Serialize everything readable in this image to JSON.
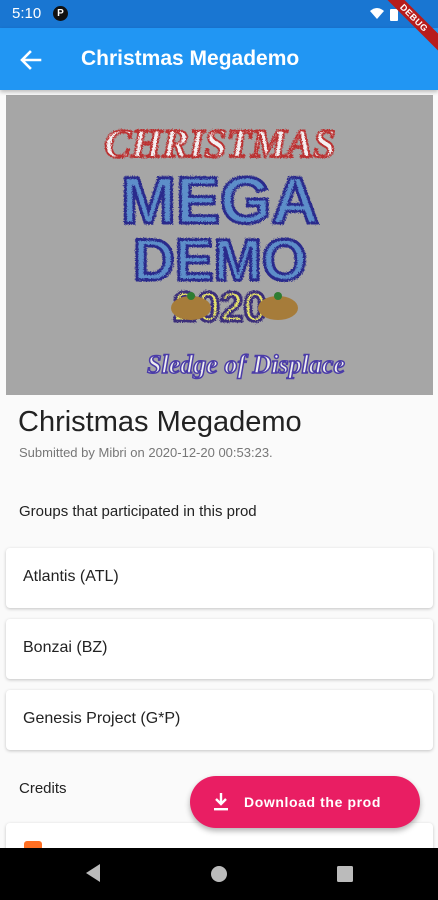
{
  "status_bar": {
    "time": "5:10",
    "notification_icon": "P"
  },
  "debug_banner": "DEBUG",
  "app_bar": {
    "title": "Christmas Megademo",
    "back_icon": "arrow-left"
  },
  "cover": {
    "background": "#a6a6a6",
    "logo_lines": [
      "CHRISTMAS",
      "MEGA",
      "DEMO",
      "2020"
    ],
    "signature": "Sledge of Displace"
  },
  "prod": {
    "title": "Christmas Megademo",
    "submitted": "Submitted by Mibri on 2020-12-20 00:53:23."
  },
  "groups": {
    "heading": "Groups that participated in this prod",
    "items": [
      "Atlantis (ATL)",
      "Bonzai (BZ)",
      "Genesis Project (G*P)"
    ]
  },
  "credits": {
    "heading": "Credits"
  },
  "fab": {
    "label": "Download the prod",
    "icon": "download",
    "color": "#e91e63"
  },
  "colors": {
    "app_bar": "#2196f3",
    "status_bar": "#1976d2"
  }
}
